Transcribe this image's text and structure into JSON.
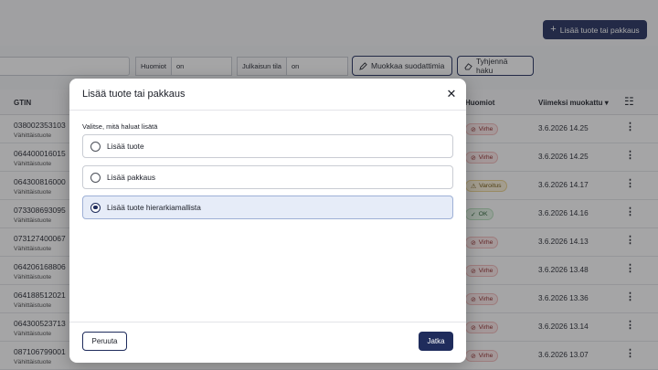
{
  "header": {
    "add_button_label": "Lisää tuote tai pakkaus",
    "add_icon": "plus-icon"
  },
  "filters": {
    "notes_label": "Huomiot",
    "notes_value": "on",
    "publish_label": "Julkaisun tila",
    "publish_value": "on",
    "edit_filters_label": "Muokkaa suodattimia",
    "edit_filters_icon": "pencil-icon",
    "clear_search_label": "Tyhjennä haku",
    "clear_search_icon": "eraser-icon"
  },
  "table": {
    "columns": {
      "gtin": "GTIN",
      "notes": "Huomiot",
      "modified": "Viimeksi muokattu",
      "modified_sort_icon": "caret-down-icon",
      "settings_icon": "sliders-icon"
    },
    "rows": [
      {
        "gtin": "038002353103",
        "type": "Vähittäistuote",
        "badge": "Virhe",
        "status": "error",
        "date": "3.6.2026 14.25"
      },
      {
        "gtin": "064400016015",
        "type": "Vähittäistuote",
        "badge": "Virhe",
        "status": "error",
        "date": "3.6.2026 14.25"
      },
      {
        "gtin": "064300816000",
        "type": "Vähittäistuote",
        "badge": "Varoitus",
        "status": "warning",
        "date": "3.6.2026 14.17"
      },
      {
        "gtin": "073308693095",
        "type": "Vähittäistuote",
        "badge": "OK",
        "status": "ok",
        "date": "3.6.2026 14.16"
      },
      {
        "gtin": "073127400067",
        "type": "Vähittäistuote",
        "badge": "Virhe",
        "status": "error",
        "date": "3.6.2026 14.13"
      },
      {
        "gtin": "064206168806",
        "type": "Vähittäistuote",
        "badge": "Virhe",
        "status": "error",
        "date": "3.6.2026 13.48"
      },
      {
        "gtin": "064188512021",
        "type": "Vähittäistuote",
        "badge": "Virhe",
        "status": "error",
        "date": "3.6.2026 13.36"
      },
      {
        "gtin": "064300523713",
        "type": "Vähittäistuote",
        "badge": "Virhe",
        "status": "error",
        "date": "3.6.2026 13.14"
      },
      {
        "gtin": "087106799001",
        "type": "Vähittäistuote",
        "badge": "Virhe",
        "status": "error",
        "date": "3.6.2026 13.07"
      }
    ]
  },
  "modal": {
    "title": "Lisää tuote tai pakkaus",
    "close_icon": "close-icon",
    "instruction": "Valitse, mitä haluat lisätä",
    "options": [
      {
        "label": "Lisää tuote",
        "selected": false
      },
      {
        "label": "Lisää pakkaus",
        "selected": false
      },
      {
        "label": "Lisää tuote hierarkiamallista",
        "selected": true
      }
    ],
    "cancel_label": "Peruuta",
    "next_label": "Jatka"
  },
  "colors": {
    "primary": "#1f2c5c",
    "error_bg": "#fde8e8",
    "warning_bg": "#fbf1d7",
    "ok_bg": "#e3f4e6",
    "selected_bg": "#e6ecf8"
  }
}
